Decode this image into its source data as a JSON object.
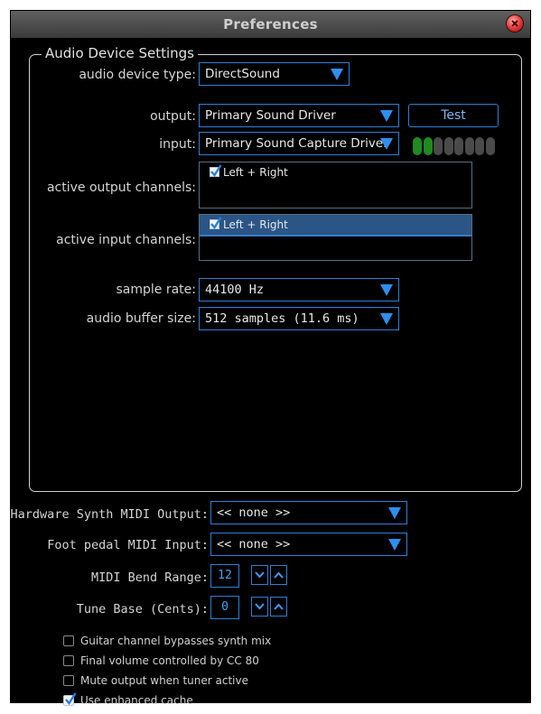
{
  "window": {
    "title": "Preferences"
  },
  "audio": {
    "group_title": "Audio Device Settings",
    "device_type_label": "audio device type:",
    "device_type_value": "DirectSound",
    "output_label": "output:",
    "output_value": "Primary Sound Driver",
    "test_label": "Test",
    "input_label": "input:",
    "input_value": "Primary Sound Capture Driver",
    "input_level_segments_lit": 2,
    "input_level_segments_total": 8,
    "active_output_label": "active output channels:",
    "active_output_channels": [
      {
        "label": "Left + Right",
        "checked": true,
        "selected": false
      }
    ],
    "active_input_label": "active input channels:",
    "active_input_channels": [
      {
        "label": "Left + Right",
        "checked": true,
        "selected": true
      }
    ],
    "sample_rate_label": "sample rate:",
    "sample_rate_value": "44100 Hz",
    "buffer_label": "audio buffer size:",
    "buffer_value": "512 samples (11.6 ms)"
  },
  "midi": {
    "synth_output_label": "Hardware Synth MIDI Output:",
    "synth_output_value": "<< none >>",
    "foot_pedal_label": "Foot pedal MIDI Input:",
    "foot_pedal_value": "<< none >>",
    "bend_range_label": "MIDI Bend Range:",
    "bend_range_value": "12",
    "tune_base_label": "Tune Base (Cents):",
    "tune_base_value": "0"
  },
  "options": [
    {
      "label": "Guitar channel bypasses synth mix",
      "checked": false
    },
    {
      "label": "Final volume controlled by CC 80",
      "checked": false
    },
    {
      "label": "Mute output when tuner active",
      "checked": false
    },
    {
      "label": "Use enhanced cache",
      "checked": true
    }
  ],
  "colors": {
    "accent": "#2e7fd4",
    "meter_on": "#1f8a1f",
    "meter_off": "#4a4a4a"
  }
}
